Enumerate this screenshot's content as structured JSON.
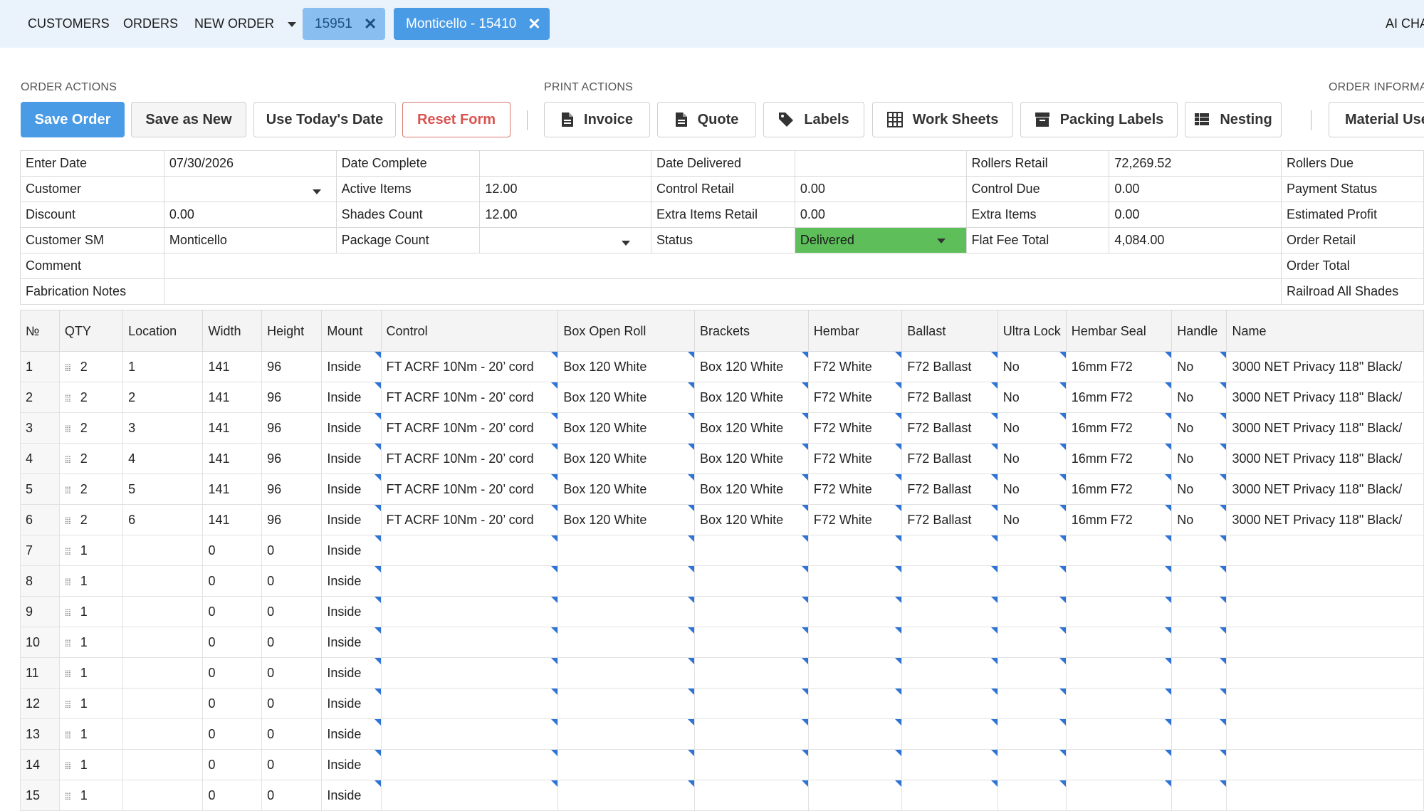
{
  "nav": {
    "customers": "CUSTOMERS",
    "orders": "ORDERS",
    "new_order": "NEW ORDER",
    "tab1": "15951",
    "tab2": "Monticello - 15410",
    "ai": "AI CHA",
    "tab1_color": "#88bff0",
    "tab2_color": "#4a9be6"
  },
  "order_actions": {
    "label": "ORDER ACTIONS",
    "save": "Save Order",
    "save_new": "Save as New",
    "today": "Use Today's Date",
    "reset": "Reset Form"
  },
  "print_actions": {
    "label": "PRINT ACTIONS",
    "invoice": "Invoice",
    "quote": "Quote",
    "labels": "Labels",
    "work_sheets": "Work Sheets",
    "packing_labels": "Packing Labels",
    "nesting": "Nesting",
    "material": "Material Use"
  },
  "order_info": {
    "label": "ORDER INFORMA"
  },
  "info": {
    "enter_date_label": "Enter Date",
    "enter_date": "07/30/2026",
    "date_complete_label": "Date Complete",
    "date_complete": "",
    "date_delivered_label": "Date Delivered",
    "date_delivered": "",
    "rollers_retail_label": "Rollers Retail",
    "rollers_retail": "72,269.52",
    "rollers_due_label": "Rollers Due",
    "customer_label": "Customer",
    "customer": "",
    "active_items_label": "Active Items",
    "active_items": "12.00",
    "control_retail_label": "Control Retail",
    "control_retail": "0.00",
    "control_due_label": "Control Due",
    "control_due": "0.00",
    "payment_status_label": "Payment Status",
    "discount_label": "Discount",
    "discount": "0.00",
    "shades_count_label": "Shades Count",
    "shades_count": "12.00",
    "extra_items_retail_label": "Extra Items Retail",
    "extra_items_retail": "0.00",
    "extra_items_label": "Extra Items",
    "extra_items": "0.00",
    "estimated_profit_label": "Estimated Profit",
    "customer_sm_label": "Customer SM",
    "customer_sm": "Monticello",
    "package_count_label": "Package Count",
    "package_count": "",
    "status_label": "Status",
    "status": "Delivered",
    "status_color": "#5dbe5a",
    "flat_fee_label": "Flat Fee Total",
    "flat_fee": "4,084.00",
    "order_retail_label": "Order Retail",
    "comment_label": "Comment",
    "order_total_label": "Order Total",
    "fab_notes_label": "Fabrication Notes",
    "railroad_label": "Railroad All Shades"
  },
  "table": {
    "headers": [
      "№",
      "QTY",
      "Location",
      "Width",
      "Height",
      "Mount",
      "Control",
      "Box Open Roll",
      "Brackets",
      "Hembar",
      "Ballast",
      "Ultra Lock",
      "Hembar Seal",
      "Handle",
      "Name"
    ],
    "rows": [
      {
        "n": "1",
        "qty": "2",
        "loc": "1",
        "w": "141",
        "h": "96",
        "mount": "Inside",
        "control": "FT ACRF 10Nm - 20’ cord",
        "box": "Box 120 White",
        "brackets": "Box 120 White",
        "hembar": "F72 White",
        "ballast": "F72 Ballast",
        "ultra": "No",
        "seal": "16mm F72",
        "handle": "No",
        "name": "3000 NET Privacy 118\" Black/"
      },
      {
        "n": "2",
        "qty": "2",
        "loc": "2",
        "w": "141",
        "h": "96",
        "mount": "Inside",
        "control": "FT ACRF 10Nm - 20’ cord",
        "box": "Box 120 White",
        "brackets": "Box 120 White",
        "hembar": "F72 White",
        "ballast": "F72 Ballast",
        "ultra": "No",
        "seal": "16mm F72",
        "handle": "No",
        "name": "3000 NET Privacy 118\" Black/"
      },
      {
        "n": "3",
        "qty": "2",
        "loc": "3",
        "w": "141",
        "h": "96",
        "mount": "Inside",
        "control": "FT ACRF 10Nm - 20’ cord",
        "box": "Box 120 White",
        "brackets": "Box 120 White",
        "hembar": "F72 White",
        "ballast": "F72 Ballast",
        "ultra": "No",
        "seal": "16mm F72",
        "handle": "No",
        "name": "3000 NET Privacy 118\" Black/"
      },
      {
        "n": "4",
        "qty": "2",
        "loc": "4",
        "w": "141",
        "h": "96",
        "mount": "Inside",
        "control": "FT ACRF 10Nm - 20’ cord",
        "box": "Box 120 White",
        "brackets": "Box 120 White",
        "hembar": "F72 White",
        "ballast": "F72 Ballast",
        "ultra": "No",
        "seal": "16mm F72",
        "handle": "No",
        "name": "3000 NET Privacy 118\" Black/"
      },
      {
        "n": "5",
        "qty": "2",
        "loc": "5",
        "w": "141",
        "h": "96",
        "mount": "Inside",
        "control": "FT ACRF 10Nm - 20’ cord",
        "box": "Box 120 White",
        "brackets": "Box 120 White",
        "hembar": "F72 White",
        "ballast": "F72 Ballast",
        "ultra": "No",
        "seal": "16mm F72",
        "handle": "No",
        "name": "3000 NET Privacy 118\" Black/"
      },
      {
        "n": "6",
        "qty": "2",
        "loc": "6",
        "w": "141",
        "h": "96",
        "mount": "Inside",
        "control": "FT ACRF 10Nm - 20’ cord",
        "box": "Box 120 White",
        "brackets": "Box 120 White",
        "hembar": "F72 White",
        "ballast": "F72 Ballast",
        "ultra": "No",
        "seal": "16mm F72",
        "handle": "No",
        "name": "3000 NET Privacy 118\" Black/"
      },
      {
        "n": "7",
        "qty": "1",
        "loc": "",
        "w": "0",
        "h": "0",
        "mount": "Inside",
        "control": "",
        "box": "",
        "brackets": "",
        "hembar": "",
        "ballast": "",
        "ultra": "",
        "seal": "",
        "handle": "",
        "name": ""
      },
      {
        "n": "8",
        "qty": "1",
        "loc": "",
        "w": "0",
        "h": "0",
        "mount": "Inside",
        "control": "",
        "box": "",
        "brackets": "",
        "hembar": "",
        "ballast": "",
        "ultra": "",
        "seal": "",
        "handle": "",
        "name": ""
      },
      {
        "n": "9",
        "qty": "1",
        "loc": "",
        "w": "0",
        "h": "0",
        "mount": "Inside",
        "control": "",
        "box": "",
        "brackets": "",
        "hembar": "",
        "ballast": "",
        "ultra": "",
        "seal": "",
        "handle": "",
        "name": ""
      },
      {
        "n": "10",
        "qty": "1",
        "loc": "",
        "w": "0",
        "h": "0",
        "mount": "Inside",
        "control": "",
        "box": "",
        "brackets": "",
        "hembar": "",
        "ballast": "",
        "ultra": "",
        "seal": "",
        "handle": "",
        "name": ""
      },
      {
        "n": "11",
        "qty": "1",
        "loc": "",
        "w": "0",
        "h": "0",
        "mount": "Inside",
        "control": "",
        "box": "",
        "brackets": "",
        "hembar": "",
        "ballast": "",
        "ultra": "",
        "seal": "",
        "handle": "",
        "name": ""
      },
      {
        "n": "12",
        "qty": "1",
        "loc": "",
        "w": "0",
        "h": "0",
        "mount": "Inside",
        "control": "",
        "box": "",
        "brackets": "",
        "hembar": "",
        "ballast": "",
        "ultra": "",
        "seal": "",
        "handle": "",
        "name": ""
      },
      {
        "n": "13",
        "qty": "1",
        "loc": "",
        "w": "0",
        "h": "0",
        "mount": "Inside",
        "control": "",
        "box": "",
        "brackets": "",
        "hembar": "",
        "ballast": "",
        "ultra": "",
        "seal": "",
        "handle": "",
        "name": ""
      },
      {
        "n": "14",
        "qty": "1",
        "loc": "",
        "w": "0",
        "h": "0",
        "mount": "Inside",
        "control": "",
        "box": "",
        "brackets": "",
        "hembar": "",
        "ballast": "",
        "ultra": "",
        "seal": "",
        "handle": "",
        "name": ""
      },
      {
        "n": "15",
        "qty": "1",
        "loc": "",
        "w": "0",
        "h": "0",
        "mount": "Inside",
        "control": "",
        "box": "",
        "brackets": "",
        "hembar": "",
        "ballast": "",
        "ultra": "",
        "seal": "",
        "handle": "",
        "name": ""
      }
    ]
  }
}
